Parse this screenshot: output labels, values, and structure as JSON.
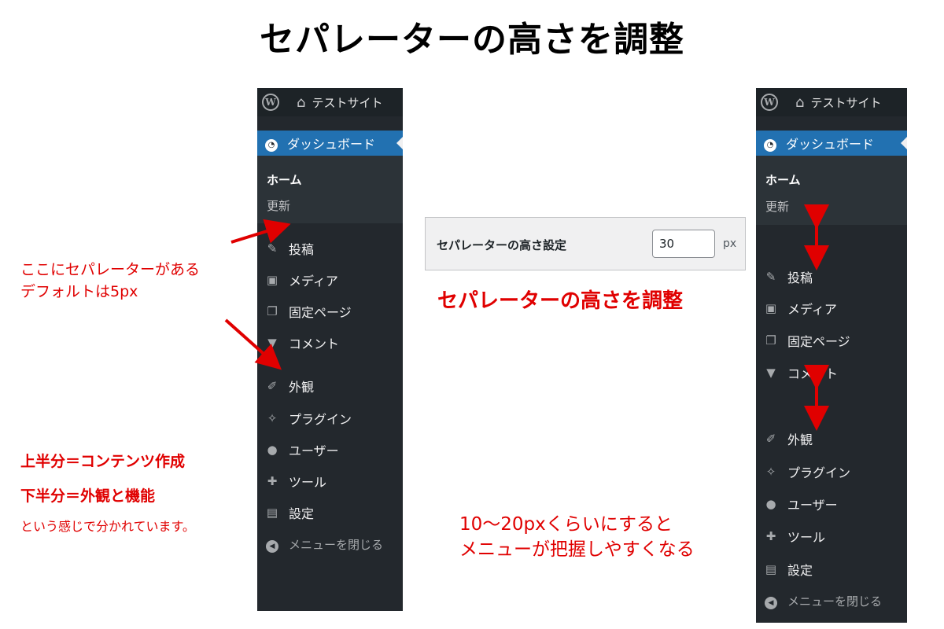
{
  "title": "セパレーターの高さを調整",
  "left_menu": {
    "site_name": "テストサイト",
    "dashboard": "ダッシュボード",
    "submenu": [
      "ホーム",
      "更新"
    ],
    "items": [
      "投稿",
      "メディア",
      "固定ページ",
      "コメント",
      "外観",
      "プラグイン",
      "ユーザー",
      "ツール",
      "設定"
    ],
    "collapse": "メニューを閉じる"
  },
  "right_menu": {
    "site_name": "テストサイト",
    "dashboard": "ダッシュボード",
    "submenu": [
      "ホーム",
      "更新"
    ],
    "items": [
      "投稿",
      "メディア",
      "固定ページ",
      "コメント",
      "外観",
      "プラグイン",
      "ユーザー",
      "ツール",
      "設定"
    ],
    "collapse": "メニューを閉じる"
  },
  "setting": {
    "label": "セパレーターの高さ設定",
    "value": "30",
    "unit": "px"
  },
  "annotations": {
    "separator_note_1": "ここにセパレーターがある",
    "separator_note_2": "デフォルトは5px",
    "upper_half": "上半分＝コンテンツ作成",
    "lower_half": "下半分＝外観と機能",
    "split_note": "という感じで分かれています。",
    "adjust_caption": "セパレーターの高さを調整",
    "recommend_1": "10～20pxくらいにすると",
    "recommend_2": "メニューが把握しやすくなる"
  },
  "colors": {
    "annotation": "#e00000",
    "wp_dark": "#23282d",
    "wp_blue": "#2271b1"
  }
}
